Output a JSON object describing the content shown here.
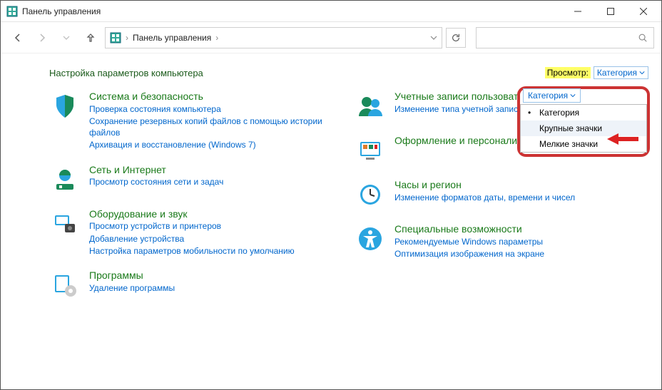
{
  "window": {
    "title": "Панель управления"
  },
  "nav": {
    "breadcrumb_root": "Панель управления"
  },
  "heading": "Настройка параметров компьютера",
  "viewby_label": "Просмотр:",
  "viewby_value": "Категория",
  "menu": {
    "header": "Категория",
    "items": [
      {
        "label": "Категория",
        "selected": true
      },
      {
        "label": "Крупные значки",
        "highlighted": true
      },
      {
        "label": "Мелкие значки"
      }
    ]
  },
  "columns": [
    [
      {
        "title": "Система и безопасность",
        "icon": "shield",
        "links": [
          "Проверка состояния компьютера",
          "Сохранение резервных копий файлов с помощью истории файлов",
          "Архивация и восстановление (Windows 7)"
        ]
      },
      {
        "title": "Сеть и Интернет",
        "icon": "network",
        "links": [
          "Просмотр состояния сети и задач"
        ]
      },
      {
        "title": "Оборудование и звук",
        "icon": "hardware",
        "links": [
          "Просмотр устройств и принтеров",
          "Добавление устройства",
          "Настройка параметров мобильности по умолчанию"
        ]
      },
      {
        "title": "Программы",
        "icon": "programs",
        "links": [
          "Удаление программы"
        ]
      }
    ],
    [
      {
        "title": "Учетные записи пользователей",
        "icon": "users",
        "links": [
          "Изменение типа учетной записи"
        ]
      },
      {
        "title": "Оформление и персонализация",
        "icon": "appearance",
        "links": []
      },
      {
        "title": "Часы и регион",
        "icon": "clock",
        "links": [
          "Изменение форматов даты, времени и чисел"
        ]
      },
      {
        "title": "Специальные возможности",
        "icon": "accessibility",
        "links": [
          "Рекомендуемые Windows параметры",
          "Оптимизация изображения на экране"
        ]
      }
    ]
  ]
}
